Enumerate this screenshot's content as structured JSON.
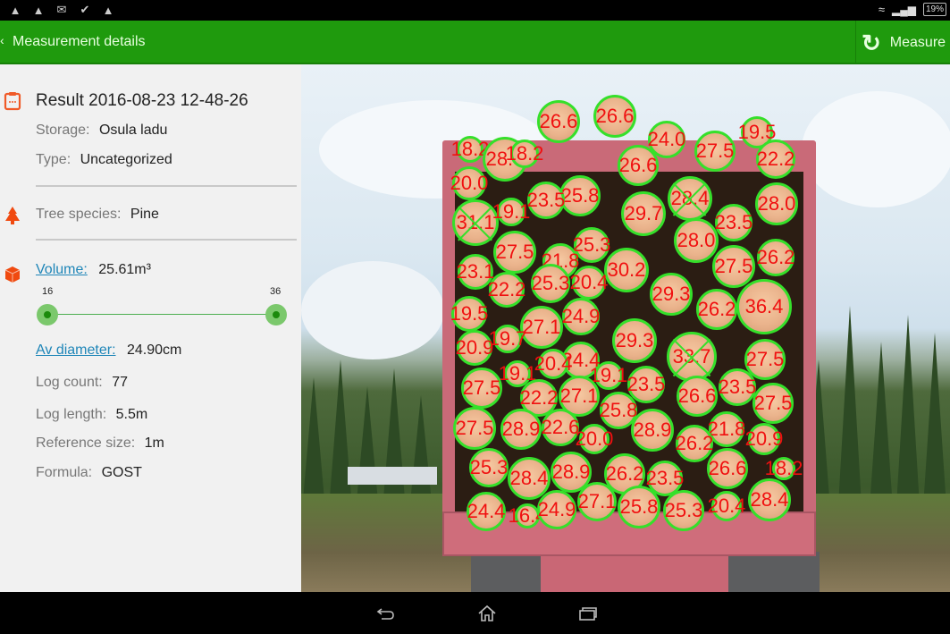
{
  "statusbar": {
    "notification_icons": [
      "app-icon",
      "cleaner-icon",
      "gmail-icon",
      "check-icon",
      "app-alert-icon"
    ],
    "battery": "19%"
  },
  "appbar": {
    "title": "Measurement details",
    "measure_label": "Measure",
    "accent_color": "#1f9a0d"
  },
  "details": {
    "result_title": "Result 2016-08-23 12-48-26",
    "storage_label": "Storage:",
    "storage_value": "Osula ladu",
    "type_label": "Type:",
    "type_value": "Uncategorized",
    "species_label": "Tree species:",
    "species_value": "Pine",
    "volume_label": "Volume:",
    "volume_value": "25.61m³",
    "slider": {
      "min_label": "16",
      "max_label": "36",
      "low_value": 16,
      "high_value": 36
    },
    "avdiam_label": "Av diameter:",
    "avdiam_value": "24.90cm",
    "logcount_label": "Log count:",
    "logcount_value": "77",
    "loglength_label": "Log length:",
    "loglength_value": "5.5m",
    "refsize_label": "Reference size:",
    "refsize_value": "1m",
    "formula_label": "Formula:",
    "formula_value": "GOST"
  },
  "logs": [
    {
      "d": "26.6"
    },
    {
      "d": "26.6"
    },
    {
      "d": "18.2"
    },
    {
      "d": "28.9"
    },
    {
      "d": "18.2"
    },
    {
      "d": "24.0"
    },
    {
      "d": "27.5"
    },
    {
      "d": "19.5"
    },
    {
      "d": "26.6"
    },
    {
      "d": "22.2"
    },
    {
      "d": "20.0"
    },
    {
      "d": "25.8"
    },
    {
      "d": "23.5"
    },
    {
      "d": "25.8"
    },
    {
      "d": "28.4",
      "x": true
    },
    {
      "d": "28.0"
    },
    {
      "d": "31.1",
      "x": true
    },
    {
      "d": "19.1"
    },
    {
      "d": "29.7"
    },
    {
      "d": "23.5"
    },
    {
      "d": "27.5"
    },
    {
      "d": "25.3"
    },
    {
      "d": "28.0"
    },
    {
      "d": "26.2"
    },
    {
      "d": "23.1"
    },
    {
      "d": "21.8"
    },
    {
      "d": "30.2"
    },
    {
      "d": "27.5"
    },
    {
      "d": "22.2"
    },
    {
      "d": "25.3"
    },
    {
      "d": "20.4"
    },
    {
      "d": "29.3"
    },
    {
      "d": "26.2"
    },
    {
      "d": "36.4"
    },
    {
      "d": "19.5"
    },
    {
      "d": "24.9"
    },
    {
      "d": "27.1"
    },
    {
      "d": "19.7"
    },
    {
      "d": "29.3"
    },
    {
      "d": "20.9"
    },
    {
      "d": "33.7",
      "x": true
    },
    {
      "d": "27.5"
    },
    {
      "d": "24.4"
    },
    {
      "d": "20.4"
    },
    {
      "d": "19.1"
    },
    {
      "d": "19.1"
    },
    {
      "d": "27.5"
    },
    {
      "d": "23.5"
    },
    {
      "d": "23.5"
    },
    {
      "d": "22.2"
    },
    {
      "d": "27.1"
    },
    {
      "d": "26.6"
    },
    {
      "d": "27.5"
    },
    {
      "d": "25.8"
    },
    {
      "d": "27.5"
    },
    {
      "d": "28.9"
    },
    {
      "d": "22.6"
    },
    {
      "d": "28.9"
    },
    {
      "d": "21.8"
    },
    {
      "d": "20.0"
    },
    {
      "d": "26.2"
    },
    {
      "d": "20.9"
    },
    {
      "d": "25.3"
    },
    {
      "d": "28.4"
    },
    {
      "d": "28.9"
    },
    {
      "d": "26.2"
    },
    {
      "d": "23.5"
    },
    {
      "d": "26.6"
    },
    {
      "d": "18.2"
    },
    {
      "d": "24.4"
    },
    {
      "d": "16.4"
    },
    {
      "d": "24.9"
    },
    {
      "d": "27.1"
    },
    {
      "d": "25.8"
    },
    {
      "d": "25.3"
    },
    {
      "d": "20.4"
    },
    {
      "d": "28.4"
    }
  ],
  "navbar": {
    "buttons": [
      "back",
      "home",
      "recent-apps"
    ]
  }
}
